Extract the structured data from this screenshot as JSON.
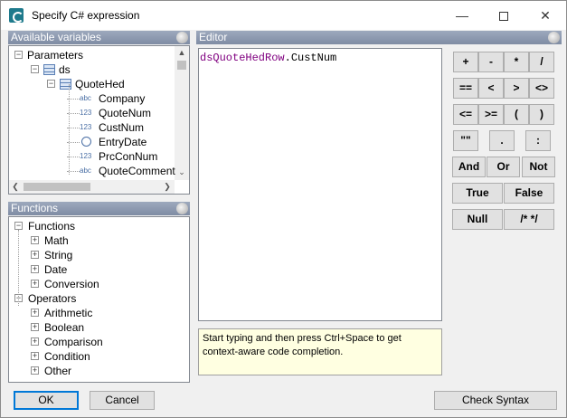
{
  "window": {
    "title": "Specify C# expression"
  },
  "available_variables": {
    "header": "Available variables",
    "items": [
      {
        "label": "Parameters",
        "level": 0,
        "expander": "−",
        "icon": "none"
      },
      {
        "label": "ds",
        "level": 1,
        "expander": "−",
        "icon": "dataset-icon"
      },
      {
        "label": "QuoteHed",
        "level": 2,
        "expander": "−",
        "icon": "table-icon"
      },
      {
        "label": "Company",
        "level": 3,
        "type": "abc"
      },
      {
        "label": "QuoteNum",
        "level": 3,
        "type": "123"
      },
      {
        "label": "CustNum",
        "level": 3,
        "type": "123"
      },
      {
        "label": "EntryDate",
        "level": 3,
        "type": "clock"
      },
      {
        "label": "PrcConNum",
        "level": 3,
        "type": "123"
      },
      {
        "label": "QuoteComment",
        "level": 3,
        "type": "abc"
      }
    ]
  },
  "functions": {
    "header": "Functions",
    "items": [
      {
        "label": "Functions",
        "level": 0,
        "expander": "−"
      },
      {
        "label": "Math",
        "level": 1,
        "expander": "+"
      },
      {
        "label": "String",
        "level": 1,
        "expander": "+"
      },
      {
        "label": "Date",
        "level": 1,
        "expander": "+"
      },
      {
        "label": "Conversion",
        "level": 1,
        "expander": "+"
      },
      {
        "label": "Operators",
        "level": 0,
        "expander": "−"
      },
      {
        "label": "Arithmetic",
        "level": 1,
        "expander": "+"
      },
      {
        "label": "Boolean",
        "level": 1,
        "expander": "+"
      },
      {
        "label": "Comparison",
        "level": 1,
        "expander": "+"
      },
      {
        "label": "Condition",
        "level": 1,
        "expander": "+"
      },
      {
        "label": "Other",
        "level": 1,
        "expander": "+"
      }
    ]
  },
  "editor": {
    "header": "Editor",
    "code_prefix": "dsQuoteHedRow",
    "code_suffix": ".CustNum",
    "hint": "Start typing and then press Ctrl+Space to get context-aware code completion."
  },
  "operators": {
    "row1": [
      "+",
      "-",
      "*",
      "/"
    ],
    "row2": [
      "==",
      "<",
      ">",
      "<>"
    ],
    "row3": [
      "<=",
      ">=",
      "(",
      ")"
    ],
    "row4": [
      "\"\"",
      ".",
      ":"
    ],
    "row5": [
      "And",
      "Or",
      "Not"
    ],
    "row6": [
      "True",
      "False"
    ],
    "row7": [
      "Null",
      "/* */"
    ]
  },
  "buttons": {
    "ok": "OK",
    "cancel": "Cancel",
    "check_syntax": "Check Syntax"
  }
}
